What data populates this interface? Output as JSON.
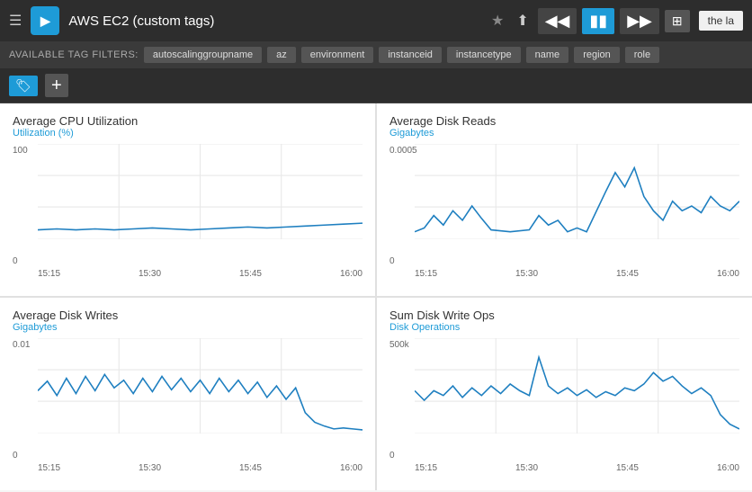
{
  "header": {
    "title": "AWS EC2 (custom tags)",
    "star_label": "★",
    "share_label": "⬆",
    "skip_back_label": "⏮",
    "pause_label": "⏸",
    "skip_forward_label": "⏭",
    "grid_label": "⊞",
    "tab_label": "the la"
  },
  "tag_filters": {
    "label": "AVAILABLE TAG FILTERS:",
    "tags": [
      "autoscalinggroupname",
      "az",
      "environment",
      "instanceid",
      "instancetype",
      "name",
      "region",
      "role"
    ]
  },
  "charts": [
    {
      "title": "Average CPU Utilization",
      "subtitle": "Utilization (%)",
      "y_top": "100",
      "y_bottom": "0",
      "x_labels": [
        "15:15",
        "15:30",
        "15:45",
        "16:00"
      ],
      "type": "cpu"
    },
    {
      "title": "Average Disk Reads",
      "subtitle": "Gigabytes",
      "y_top": "0.0005",
      "y_bottom": "0",
      "x_labels": [
        "15:15",
        "15:30",
        "15:45",
        "16:00"
      ],
      "type": "disk_reads"
    },
    {
      "title": "Average Disk Writes",
      "subtitle": "Gigabytes",
      "y_top": "0.01",
      "y_bottom": "0",
      "x_labels": [
        "15:15",
        "15:30",
        "15:45",
        "16:00"
      ],
      "type": "disk_writes"
    },
    {
      "title": "Sum Disk Write Ops",
      "subtitle": "Disk Operations",
      "y_top": "500k",
      "y_bottom": "0",
      "x_labels": [
        "15:15",
        "15:30",
        "15:45",
        "16:00"
      ],
      "type": "disk_write_ops"
    }
  ]
}
